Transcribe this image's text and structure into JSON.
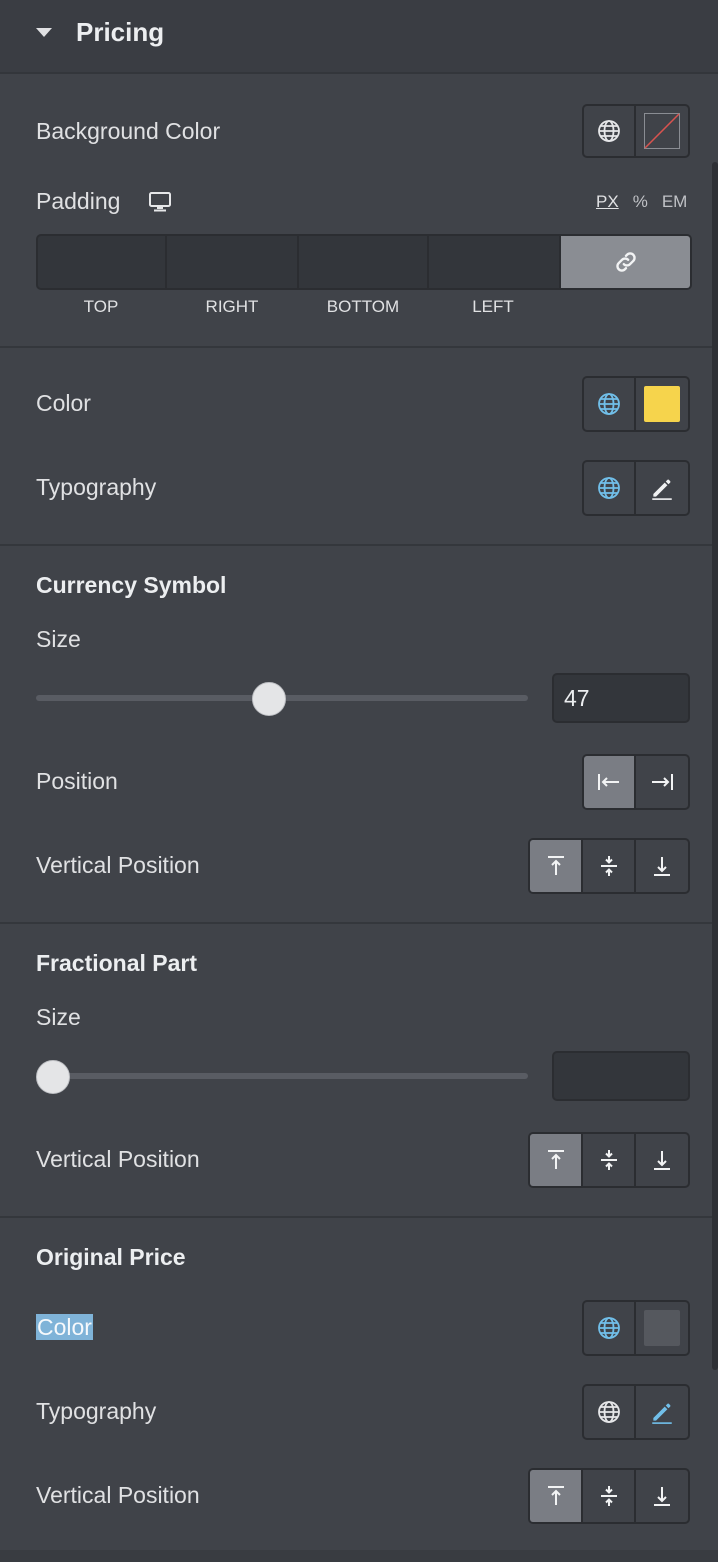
{
  "panel": {
    "title": "Pricing"
  },
  "pricing": {
    "background_color_label": "Background Color",
    "padding_label": "Padding",
    "units": [
      "PX",
      "%",
      "EM"
    ],
    "padding_sides": [
      "TOP",
      "RIGHT",
      "BOTTOM",
      "LEFT"
    ],
    "color_label": "Color",
    "color_value": "#f6d44c",
    "typography_label": "Typography"
  },
  "currency_symbol": {
    "heading": "Currency Symbol",
    "size_label": "Size",
    "size_value": "47",
    "slider_fraction": 0.47,
    "position_label": "Position",
    "vertical_position_label": "Vertical Position"
  },
  "fractional_part": {
    "heading": "Fractional Part",
    "size_label": "Size",
    "size_value": "",
    "slider_fraction": 0,
    "vertical_position_label": "Vertical Position"
  },
  "original_price": {
    "heading": "Original Price",
    "color_label": "Color",
    "color_value": "#55585e",
    "typography_label": "Typography",
    "vertical_position_label": "Vertical Position"
  },
  "icons": {
    "collapse": "caret-down-icon",
    "globe": "globe-icon",
    "responsive": "desktop-icon",
    "link": "link-icon",
    "edit": "pencil-icon",
    "align_start": "align-left-bar-icon",
    "align_end": "align-right-bar-icon",
    "v_top": "valign-top-icon",
    "v_middle": "valign-middle-icon",
    "v_bottom": "valign-bottom-icon"
  },
  "colors": {
    "accent_blue": "#71bfe9",
    "panel_bg": "#404349",
    "active_btn": "#7a7d84"
  }
}
